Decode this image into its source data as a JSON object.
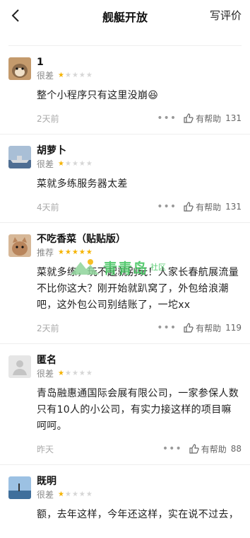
{
  "header": {
    "title": "舰艇开放",
    "write_review_label": "写评价"
  },
  "watermark": {
    "text": "青青岛",
    "sub": "社区"
  },
  "reviews": [
    {
      "name": "1",
      "rating_label": "很差",
      "stars": 1,
      "content": "整个小程序只有这里没崩😆",
      "date": "2天前",
      "helpful_label": "有帮助",
      "helpful_count": "131",
      "avatar_color": "#8a6a4a"
    },
    {
      "name": "胡萝卜",
      "rating_label": "很差",
      "stars": 1,
      "content": "菜就多练服务器太差",
      "date": "4天前",
      "helpful_label": "有帮助",
      "helpful_count": "131",
      "avatar_color": "#6d87a8"
    },
    {
      "name": "不吃香菜（贴贴版）",
      "rating_label": "推荐",
      "stars": 5,
      "content": "菜就多练，玩不起就别玩！人家长春航展流量不比你这大？刚开始就趴窝了，外包给浪潮吧，这外包公司别结账了，一坨xx",
      "date": "2天前",
      "helpful_label": "有帮助",
      "helpful_count": "119",
      "avatar_color": "#b9855c"
    },
    {
      "name": "匿名",
      "rating_label": "很差",
      "stars": 1,
      "content": "青岛融惠通国际会展有限公司，一家参保人数只有10人的小公司，有实力接这样的项目嘛呵呵。",
      "date": "昨天",
      "helpful_label": "有帮助",
      "helpful_count": "88",
      "avatar_color": "#d9d9d9"
    },
    {
      "name": "既明",
      "rating_label": "很差",
      "stars": 1,
      "content": "额，去年这样，今年还这样，实在说不过去，",
      "date": "",
      "helpful_label": "",
      "helpful_count": "",
      "avatar_color": "#5b86b5"
    }
  ]
}
